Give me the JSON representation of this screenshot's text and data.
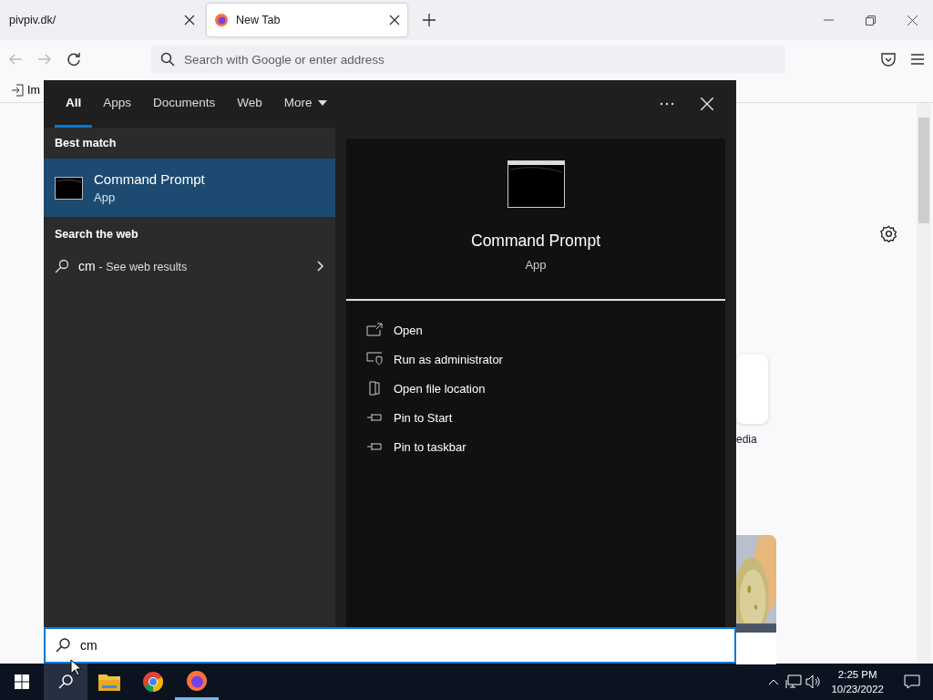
{
  "browser": {
    "tabs": [
      {
        "label": "pivpiv.dk/",
        "selected": false,
        "kind": "plain"
      },
      {
        "label": "New Tab",
        "selected": true,
        "kind": "firefox"
      }
    ],
    "address_bar": {
      "placeholder": "Search with Google or enter address"
    },
    "bookmarks": [
      {
        "label": "Im"
      }
    ],
    "shortcut_tiles": [
      {
        "label": "edia"
      }
    ]
  },
  "start_search": {
    "tabs": [
      {
        "label": "All",
        "selected": true
      },
      {
        "label": "Apps",
        "selected": false
      },
      {
        "label": "Documents",
        "selected": false
      },
      {
        "label": "Web",
        "selected": false
      },
      {
        "label": "More",
        "selected": false
      }
    ],
    "best_match_heading": "Best match",
    "best_match": {
      "name": "Command Prompt",
      "type": "App",
      "selected": true
    },
    "web_heading": "Search the web",
    "web_result": {
      "query": "cm",
      "suffix": "- See web results"
    },
    "details": {
      "name": "Command Prompt",
      "type": "App"
    },
    "actions": [
      {
        "label": "Open",
        "kind": "open"
      },
      {
        "label": "Run as administrator",
        "kind": "admin"
      },
      {
        "label": "Open file location",
        "kind": "folder"
      },
      {
        "label": "Pin to Start",
        "kind": "pin"
      },
      {
        "label": "Pin to taskbar",
        "kind": "pin"
      }
    ],
    "search_field": {
      "value": "cm"
    }
  },
  "taskbar": {
    "time": "2:25 PM",
    "date": "10/23/2022"
  }
}
